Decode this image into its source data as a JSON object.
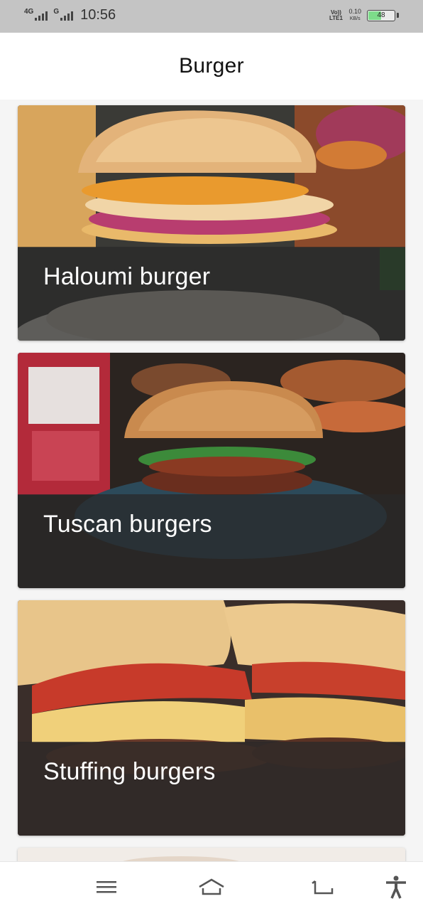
{
  "status_bar": {
    "network_1": "4G",
    "network_2": "G",
    "time": "10:56",
    "volte": "Vo)) LTE1",
    "speed_value": "0.10",
    "speed_unit": "KB/s",
    "battery": "48",
    "battery_level_pct": 48
  },
  "header": {
    "title": "Burger"
  },
  "recipes": [
    {
      "label": "Haloumi burger"
    },
    {
      "label": "Tuscan burgers"
    },
    {
      "label": "Stuffing burgers"
    }
  ],
  "nav": {
    "items": [
      {
        "icon": "menu-icon"
      },
      {
        "icon": "home-icon"
      },
      {
        "icon": "back-icon"
      },
      {
        "icon": "accessibility-icon"
      }
    ]
  },
  "colors": {
    "status_bar_bg": "#c4c4c4",
    "overlay": "#282828",
    "battery_fill": "#7ddc8a"
  }
}
